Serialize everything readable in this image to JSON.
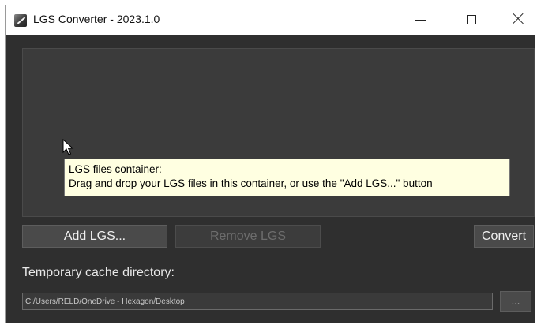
{
  "window": {
    "title": "LGS Converter - 2023.1.0",
    "controls": {
      "minimize_icon": "minimize-icon",
      "maximize_icon": "maximize-icon",
      "close_icon": "close-icon"
    }
  },
  "files_container": {
    "tooltip": {
      "line1": "LGS files container:",
      "line2": "Drag and drop your LGS files in this container, or use the \"Add LGS...\" button"
    }
  },
  "buttons": {
    "add_label": "Add LGS...",
    "remove_label": "Remove LGS",
    "remove_enabled": false,
    "convert_label": "Convert",
    "browse_label": "..."
  },
  "cache": {
    "label": "Temporary cache directory:",
    "path": "C:/Users/RELD/OneDrive - Hexagon/Desktop"
  },
  "colors": {
    "window_bg": "#2f2f2f",
    "panel_bg": "#3b3b3b",
    "button_bg": "#4a4a4a",
    "tooltip_bg": "#ffffe1",
    "text": "#f0f0f0",
    "disabled_text": "#6d6d6d"
  }
}
